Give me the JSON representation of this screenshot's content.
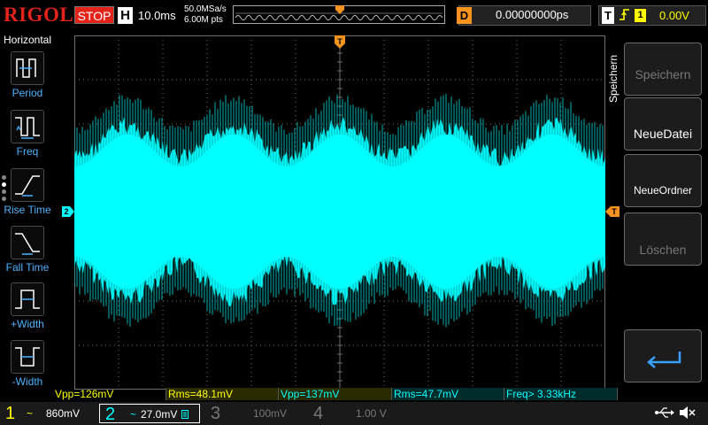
{
  "brand": "RIGOL",
  "run_status": "STOP",
  "timebase": {
    "badge": "H",
    "value": "10.0ms",
    "sample_rate": "50.0MSa/s",
    "mem_depth": "6.00M pts"
  },
  "delay": {
    "badge": "D",
    "value": "0.00000000ps"
  },
  "trigger": {
    "badge": "T",
    "edge_icon": "rising-edge-icon",
    "source": "1",
    "level": "0.00V"
  },
  "left_panel": {
    "title": "Horizontal",
    "items": [
      {
        "label": "Period",
        "icon": "period-icon"
      },
      {
        "label": "Freq",
        "icon": "frequency-icon"
      },
      {
        "label": "Rise Time",
        "icon": "rise-time-icon"
      },
      {
        "label": "Fall Time",
        "icon": "fall-time-icon"
      },
      {
        "label": "+Width",
        "icon": "positive-width-icon"
      },
      {
        "label": "-Width",
        "icon": "negative-width-icon"
      }
    ]
  },
  "trace": {
    "color": "#00ffff",
    "channel_marker": "2"
  },
  "softkeys": {
    "title": "Speichern",
    "items": [
      {
        "label": "Speichern",
        "enabled": false
      },
      {
        "label": "NeueDatei",
        "enabled": true
      },
      {
        "label": "NeueOrdner",
        "enabled": true
      },
      {
        "label": "Löschen",
        "enabled": false
      }
    ],
    "return_icon": "return-arrow-icon"
  },
  "measurements": [
    {
      "text": "Vpp=126mV",
      "color": "#ffff00"
    },
    {
      "text": "Rms=48.1mV",
      "color": "#ffff00"
    },
    {
      "text": "Vpp=137mV",
      "color": "#00ffff"
    },
    {
      "text": "Rms=47.7mV",
      "color": "#00ffff"
    },
    {
      "text": "Freq> 3.33kHz",
      "color": "#00ffff"
    }
  ],
  "channels": [
    {
      "num": "1",
      "coupling": "~",
      "scale": "860mV",
      "color": "#ffff00",
      "active": true
    },
    {
      "num": "2",
      "coupling": "~",
      "scale": "27.0mV",
      "color": "#00ffff",
      "active": true
    },
    {
      "num": "3",
      "coupling": "",
      "scale": "100mV",
      "color": "#ff00ff",
      "active": false
    },
    {
      "num": "4",
      "coupling": "",
      "scale": "1.00 V",
      "color": "#3a7bff",
      "active": false
    }
  ],
  "colors": {
    "brand": "#e4231b",
    "trigger": "#f7931e",
    "grid": "#6e6e6e",
    "ch1": "#ffff00",
    "ch2": "#00ffff"
  },
  "status_icons": [
    "usb-icon",
    "speaker-muted-icon"
  ]
}
